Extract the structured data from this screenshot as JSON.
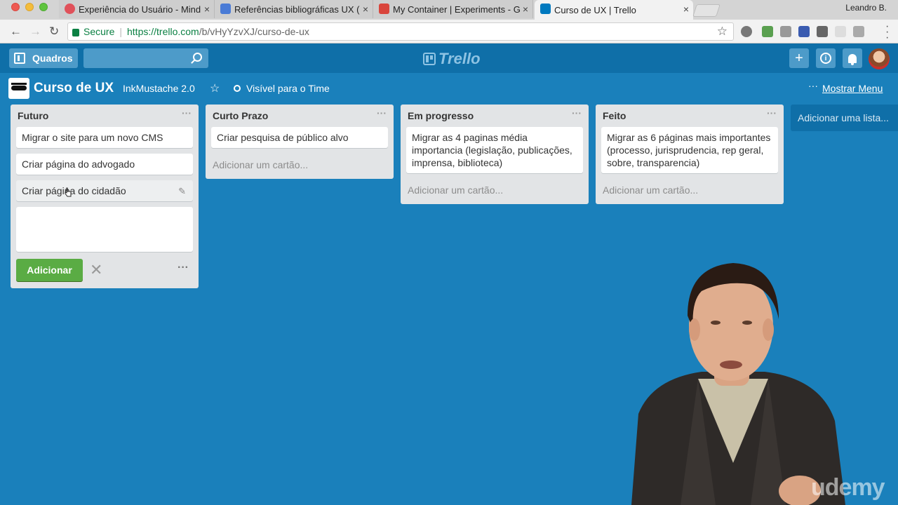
{
  "browser": {
    "tabs": [
      {
        "title": "Experiência do Usuário - Mind",
        "active": false,
        "favicon_color": "#e0515a"
      },
      {
        "title": "Referências bibliográficas UX (",
        "active": false,
        "favicon_color": "#4a7bd6"
      },
      {
        "title": "My Container | Experiments - G",
        "active": false,
        "favicon_color": "#d9453c"
      },
      {
        "title": "Curso de UX | Trello",
        "active": true,
        "favicon_color": "#0079bf"
      }
    ],
    "close_glyph": "×",
    "profile_name": "Leandro B.",
    "secure_label": "Secure",
    "url_host": "https://trello.com",
    "url_path": "/b/vHyYzvXJ/curso-de-ux"
  },
  "header": {
    "boards_label": "Quadros",
    "logo_text": "Trello"
  },
  "board": {
    "title": "Curso de UX",
    "team": "InkMustache 2.0",
    "visibility": "Visível para o Time",
    "show_menu": "Mostrar Menu"
  },
  "lists": [
    {
      "name": "Futuro",
      "cards": [
        "Migrar o site para um novo CMS",
        "Criar página do advogado",
        "Criar página do cidadão"
      ],
      "composer_open": true
    },
    {
      "name": "Curto Prazo",
      "cards": [
        "Criar pesquisa de público alvo"
      ],
      "add_card": "Adicionar um cartão..."
    },
    {
      "name": "Em progresso",
      "cards": [
        "Migrar as 4 paginas média importancia (legislação, publicações, imprensa, biblioteca)"
      ],
      "add_card": "Adicionar um cartão..."
    },
    {
      "name": "Feito",
      "cards": [
        "Migrar as 6 páginas mais importantes (processo, jurisprudencia, rep geral, sobre, transparencia)"
      ],
      "add_card": "Adicionar um cartão..."
    }
  ],
  "composer": {
    "add_button": "Adicionar"
  },
  "add_list": "Adicionar uma lista...",
  "watermark": "udemy",
  "colors": {
    "board_bg": "#1a80bb",
    "header_bg": "#0f6fa8",
    "add_button": "#5aac44"
  }
}
